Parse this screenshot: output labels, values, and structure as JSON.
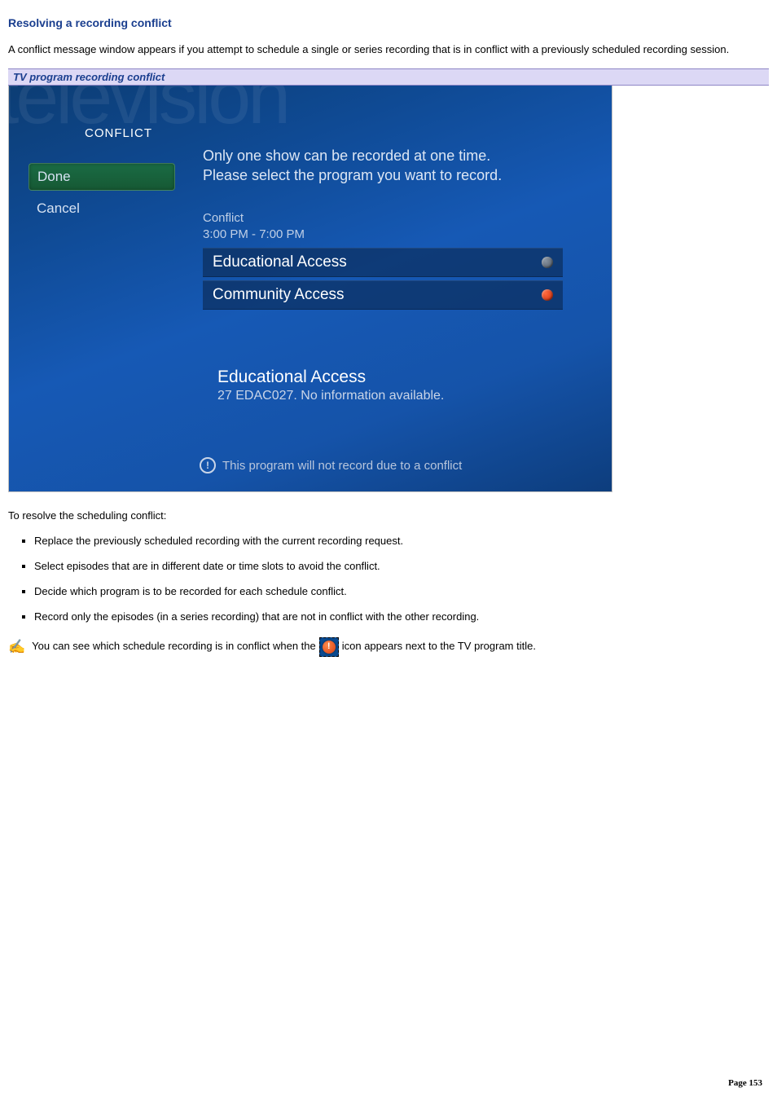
{
  "heading": "Resolving a recording conflict",
  "intro": "A conflict message window appears if you attempt to schedule a single or series recording that is in conflict with a previously scheduled recording session.",
  "caption": "TV program recording conflict",
  "mc": {
    "watermark": "television",
    "title": "CONFLICT",
    "menu": {
      "done": "Done",
      "cancel": "Cancel"
    },
    "instr_l1": "Only one show can be recorded at one time.",
    "instr_l2": "Please select the program you want to record.",
    "conflict_label": "Conflict",
    "conflict_time": "3:00 PM - 7:00 PM",
    "rows": {
      "r1": "Educational Access",
      "r2": "Community Access"
    },
    "detail_title": "Educational Access",
    "detail_sub": "27 EDAC027. No information available.",
    "footer_glyph": "!",
    "footer": "This program will not record due to a conflict"
  },
  "resolve_lead": "To resolve the scheduling conflict:",
  "bullets": {
    "b1": "Replace the previously scheduled recording with the current recording request.",
    "b2": "Select episodes that are in different date or time slots to avoid the conflict.",
    "b3": "Decide which program is to be recorded for each schedule conflict.",
    "b4": "Record only the episodes (in a series recording) that are not in conflict with the other recording."
  },
  "note": {
    "pre": "You can see which schedule recording is in conflict when the ",
    "glyph": "!",
    "post": "icon appears next to the TV program title."
  },
  "footer": {
    "label": "Page",
    "num": "153"
  }
}
